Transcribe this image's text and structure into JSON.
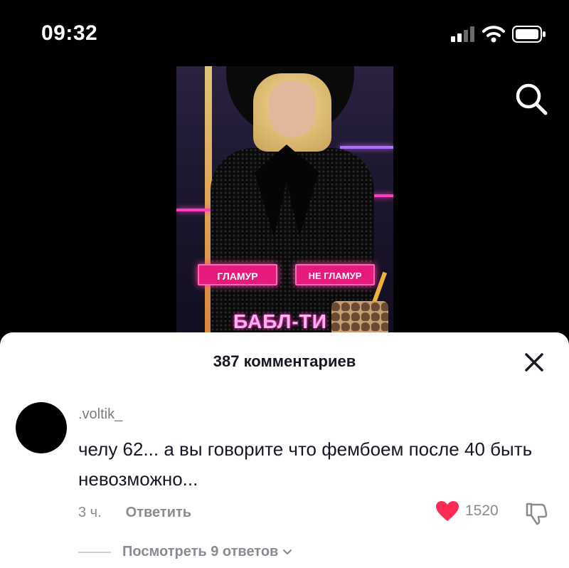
{
  "status_bar": {
    "time": "09:32",
    "icons": [
      "signal-icon",
      "wifi-icon",
      "battery-icon"
    ]
  },
  "video": {
    "tag_left": "ГЛАМУР",
    "tag_right": "НЕ ГЛАМУР",
    "banner": "БАБЛ-ТИ"
  },
  "comments_sheet": {
    "title": "387 комментариев",
    "comment": {
      "username": ".voltik_",
      "text": "челу 62... а вы говорите что фембоем после 40 быть невозможно...",
      "time": "3 ч.",
      "reply_label": "Ответить",
      "likes": "1520",
      "view_replies": "Посмотреть 9 ответов"
    }
  },
  "colors": {
    "like_heart": "#fe2c55",
    "accent_pink": "#e6197d"
  }
}
